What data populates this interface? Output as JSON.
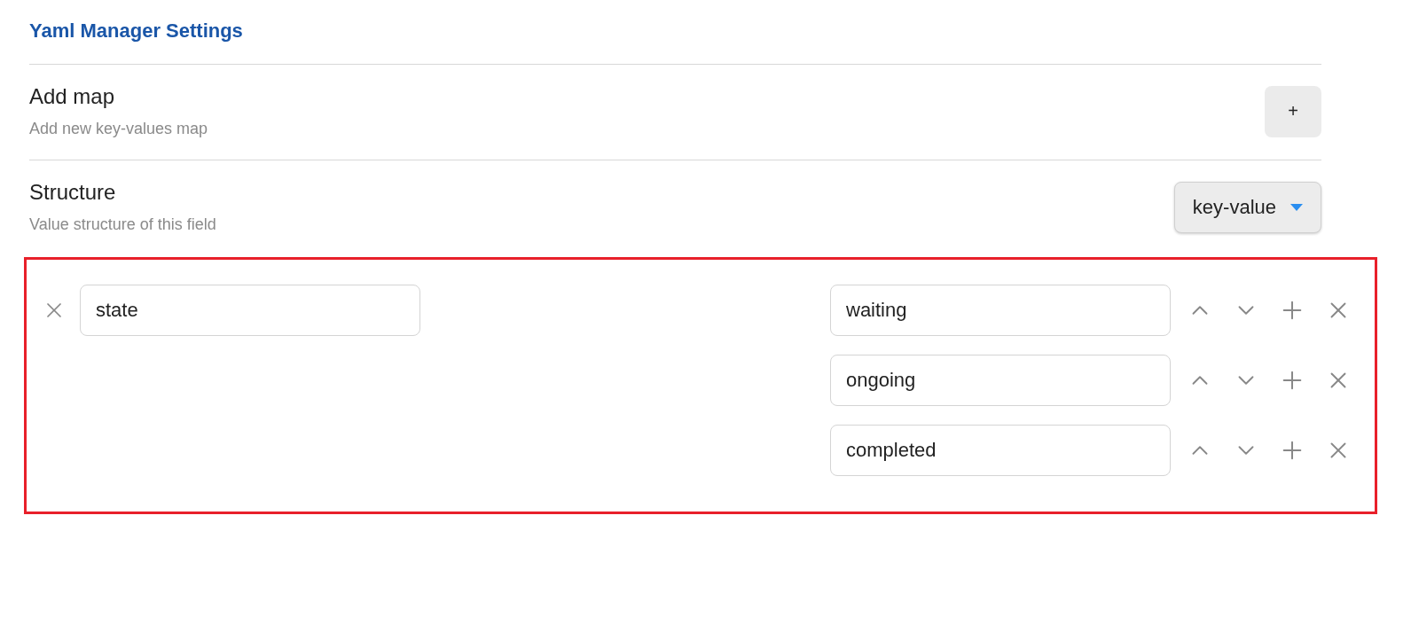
{
  "heading": "Yaml Manager Settings",
  "settings": [
    {
      "kind": "button",
      "name": "Add map",
      "description": "Add new key-values map",
      "control": "+"
    },
    {
      "kind": "dropdown",
      "name": "Structure",
      "description": "Value structure of this field",
      "control": "key-value"
    }
  ],
  "map": {
    "highlighted": true,
    "key": "state",
    "values": [
      "waiting",
      "ongoing",
      "completed"
    ]
  }
}
